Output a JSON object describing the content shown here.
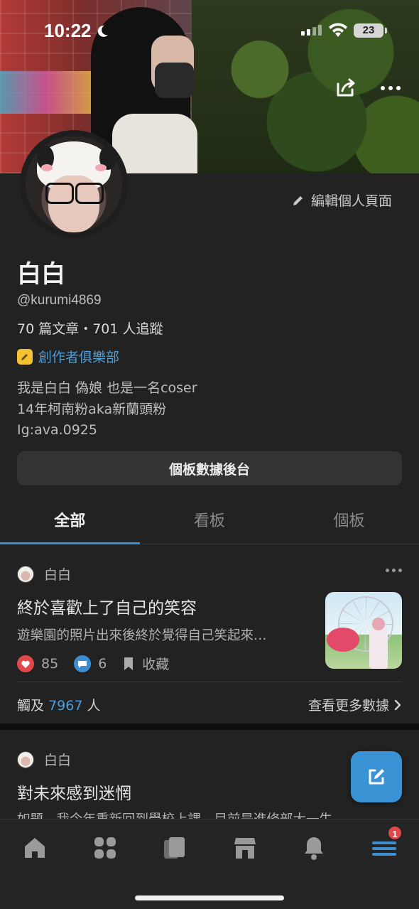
{
  "status_bar": {
    "time": "10:22",
    "battery": "23"
  },
  "profile": {
    "edit_label": "編輯個人頁面",
    "name": "白白",
    "handle": "@kurumi4869",
    "stats": "70 篇文章・701 人追蹤",
    "club_label": "創作者俱樂部",
    "bio": [
      "我是白白 偽娘 也是一名coser",
      "14年柯南粉aka新蘭頭粉",
      "Ig:ava.0925"
    ],
    "dashboard_button": "個板數據後台"
  },
  "tabs": [
    {
      "label": "全部",
      "active": true
    },
    {
      "label": "看板",
      "active": false
    },
    {
      "label": "個板",
      "active": false
    }
  ],
  "posts": [
    {
      "author": "白白",
      "title": "終於喜歡上了自己的笑容",
      "excerpt": "遊樂園的照片出來後終於覺得自己笑起來…",
      "likes": "85",
      "comments": "6",
      "save_label": "收藏",
      "reach_prefix": "觸及",
      "reach_count": "7967",
      "reach_suffix": "人",
      "more_data_label": "查看更多數據"
    },
    {
      "author": "白白",
      "title": "對未來感到迷惘",
      "excerpt": "如題，我今年重新回到學校上課，目前是進修部大一生"
    }
  ],
  "bottom_nav": {
    "items": [
      "home-icon",
      "grid-icon",
      "cards-icon",
      "shop-icon",
      "bell-icon",
      "menu-icon"
    ],
    "menu_badge": "1"
  },
  "colors": {
    "accent": "#3b8fd0",
    "link": "#4a9fdc",
    "like": "#e0484c",
    "background": "#222222"
  }
}
